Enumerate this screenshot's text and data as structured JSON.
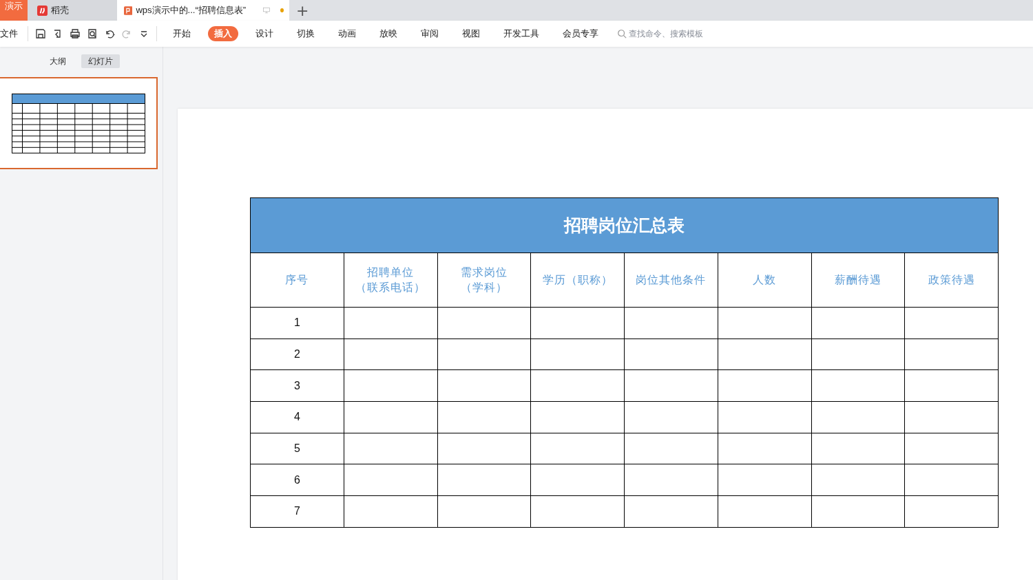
{
  "tabs": [
    {
      "label": "演示",
      "kind": "app",
      "selected": false
    },
    {
      "label": "稻壳",
      "kind": "docer",
      "selected": false
    },
    {
      "label": "wps演示中的...“招聘信息表”",
      "kind": "doc",
      "selected": true,
      "unsaved": true
    }
  ],
  "toolbar": {
    "file_menu": "文件",
    "more_symbol": "+"
  },
  "ribbon_tabs": [
    {
      "label": "开始",
      "selected": false
    },
    {
      "label": "插入",
      "selected": true
    },
    {
      "label": "设计",
      "selected": false
    },
    {
      "label": "切换",
      "selected": false
    },
    {
      "label": "动画",
      "selected": false
    },
    {
      "label": "放映",
      "selected": false
    },
    {
      "label": "审阅",
      "selected": false
    },
    {
      "label": "视图",
      "selected": false
    },
    {
      "label": "开发工具",
      "selected": false
    },
    {
      "label": "会员专享",
      "selected": false
    }
  ],
  "search": {
    "placeholder": "查找命令、搜索模板"
  },
  "panel_tabs": [
    {
      "label": "大纲",
      "selected": false
    },
    {
      "label": "幻灯片",
      "selected": true
    }
  ],
  "slide": {
    "title": "招聘岗位汇总表",
    "columns": [
      [
        "序号"
      ],
      [
        "招聘单位",
        "（联系电话）"
      ],
      [
        "需求岗位",
        "（学科）"
      ],
      [
        "学历（职称）"
      ],
      [
        "岗位其他条件"
      ],
      [
        "人数"
      ],
      [
        "薪酬待遇"
      ],
      [
        "政策待遇"
      ]
    ],
    "rows": [
      "1",
      "2",
      "3",
      "4",
      "5",
      "6",
      "7"
    ]
  }
}
